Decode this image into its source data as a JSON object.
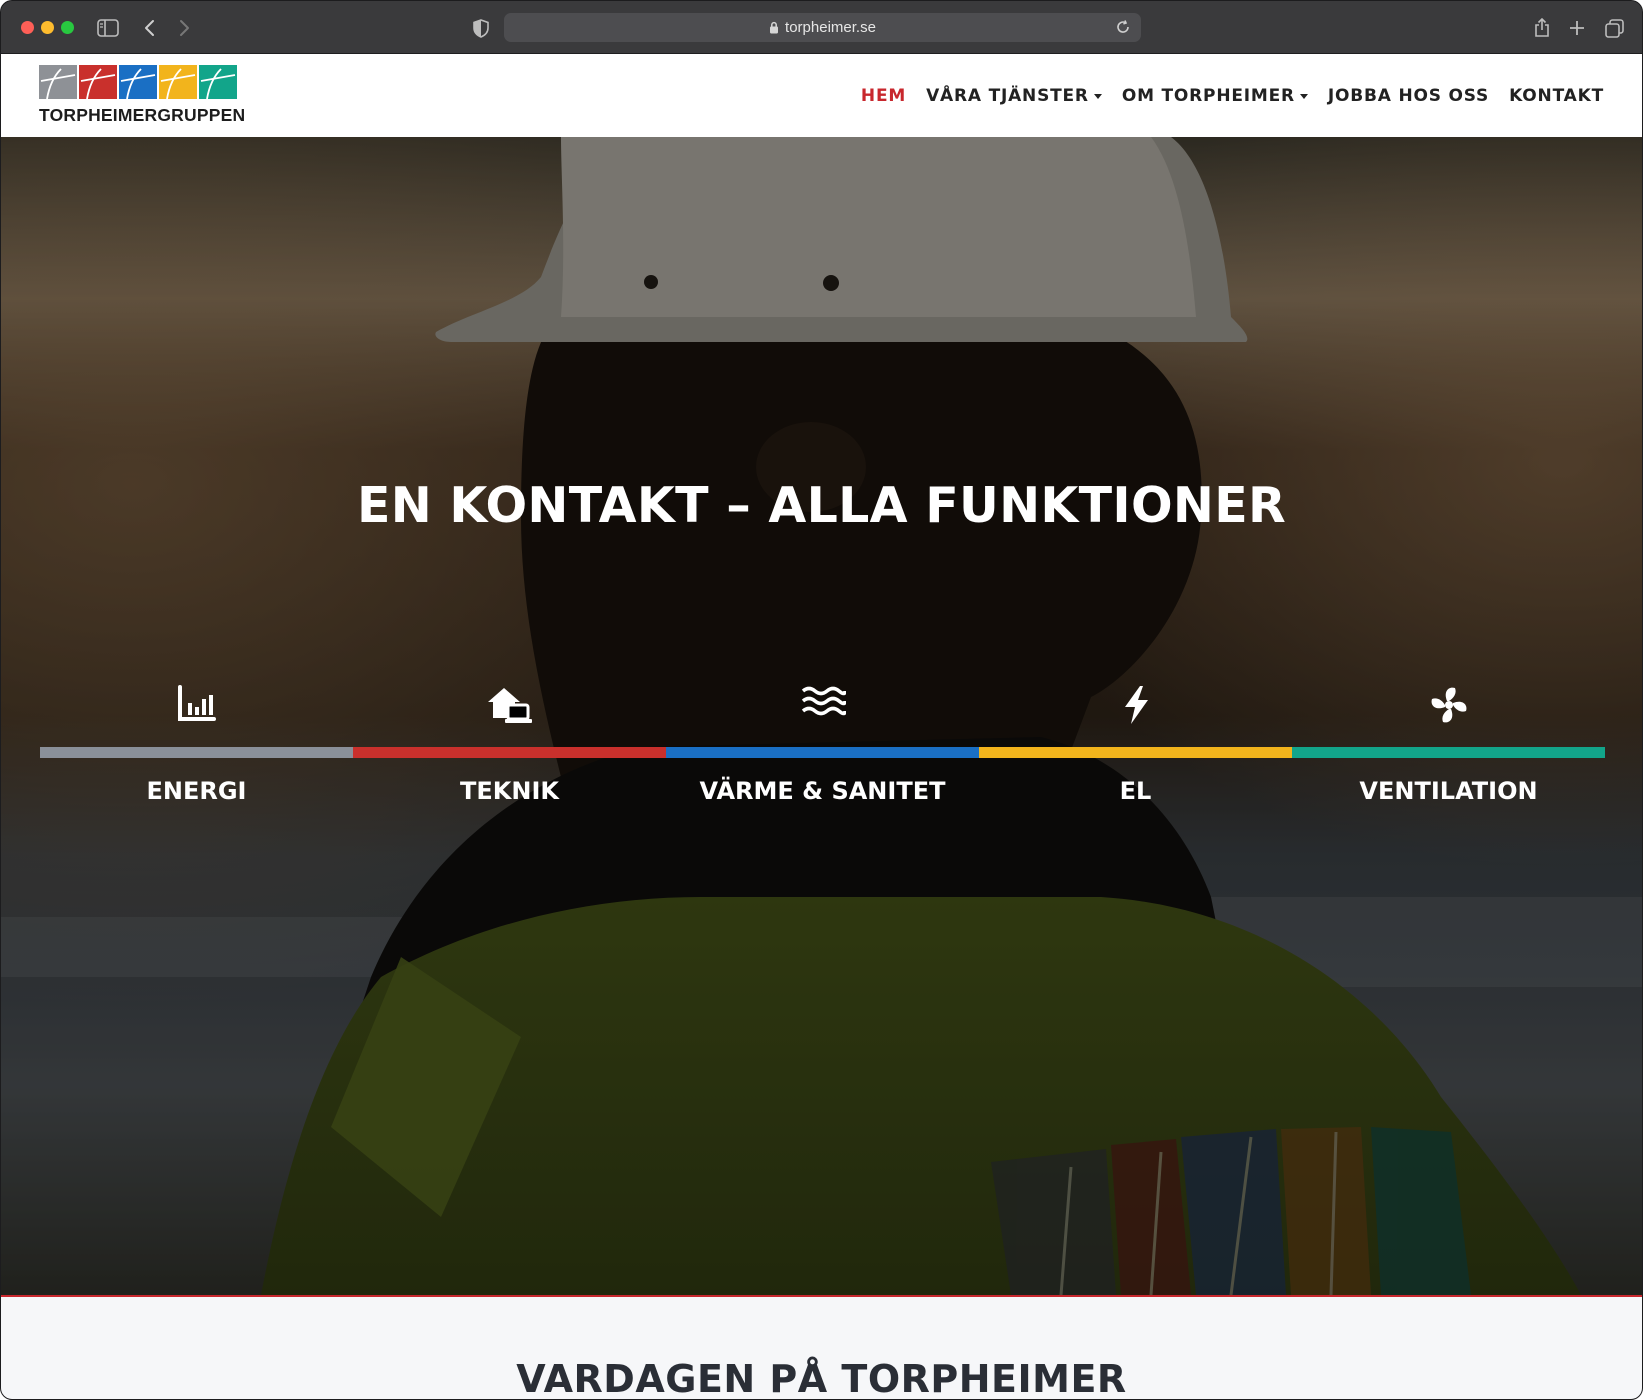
{
  "browser": {
    "url": "torpheimer.se",
    "icons": [
      "sidebar-icon",
      "back-icon",
      "forward-icon",
      "shield-icon",
      "lock-icon",
      "reload-icon",
      "share-icon",
      "new-tab-icon",
      "tab-overview-icon"
    ]
  },
  "header": {
    "logo_text": "TORPHEIMERGRUPPEN",
    "logo_colors": [
      "#8e9196",
      "#c9302c",
      "#1a6fc4",
      "#f2b41c",
      "#12a58a"
    ],
    "nav": [
      {
        "label": "HEM",
        "active": true,
        "dropdown": false
      },
      {
        "label": "VÅRA TJÄNSTER",
        "active": false,
        "dropdown": true
      },
      {
        "label": "OM TORPHEIMER",
        "active": false,
        "dropdown": true
      },
      {
        "label": "JOBBA HOS OSS",
        "active": false,
        "dropdown": false
      },
      {
        "label": "KONTAKT",
        "active": false,
        "dropdown": false
      }
    ],
    "active_color": "#c8272d"
  },
  "hero": {
    "title": "EN KONTAKT – ALLA FUNKTIONER",
    "services": [
      {
        "label": "ENERGI",
        "icon": "bar-chart-icon",
        "color": "#8a9099"
      },
      {
        "label": "TEKNIK",
        "icon": "home-devices-icon",
        "color": "#c9302c"
      },
      {
        "label": "VÄRME & SANITET",
        "icon": "water-waves-icon",
        "color": "#1a6fc4"
      },
      {
        "label": "EL",
        "icon": "lightning-icon",
        "color": "#f2b41c"
      },
      {
        "label": "VENTILATION",
        "icon": "fan-icon",
        "color": "#12a58a"
      }
    ]
  },
  "section": {
    "heading": "VARDAGEN PÅ TORPHEIMER"
  }
}
